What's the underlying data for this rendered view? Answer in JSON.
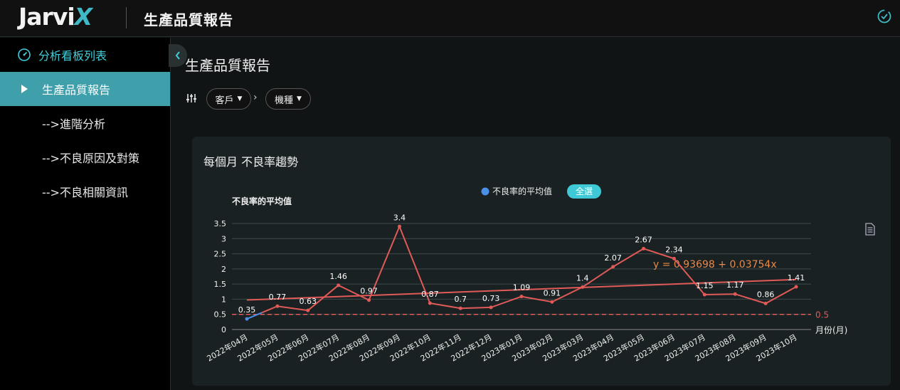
{
  "app": {
    "logo_main": "Jarvi",
    "logo_accent": "X",
    "title": "生產品質報告"
  },
  "sidebar": {
    "header": "分析看板列表",
    "items": [
      {
        "label": "生產品質報告",
        "active": true
      },
      {
        "label": "-->進階分析"
      },
      {
        "label": "-->不良原因及對策"
      },
      {
        "label": "-->不良相關資訊"
      }
    ]
  },
  "main": {
    "title": "生產品質報告",
    "filters": [
      {
        "label": "客戶"
      },
      {
        "label": "機種"
      }
    ]
  },
  "card": {
    "title": "每個月 不良率趨勢",
    "legend": {
      "series_label": "不良率的平均值",
      "select_all": "全選"
    }
  },
  "colors": {
    "accent": "#3fb9c6",
    "line": "#e05a58",
    "active_bg": "#3f9fab",
    "first_segment": "#4a8fe8",
    "trend_label": "#e8894a"
  },
  "chart_data": {
    "type": "line",
    "ylabel": "不良率的平均值",
    "xlabel": "月份(月)",
    "ylim": [
      0,
      3.5
    ],
    "yticks": [
      0,
      0.5,
      1,
      1.5,
      2,
      2.5,
      3,
      3.5
    ],
    "categories": [
      "2022年04月",
      "2022年05月",
      "2022年06月",
      "2022年07月",
      "2022年08月",
      "2022年09月",
      "2022年10月",
      "2022年11月",
      "2022年12月",
      "2023年01月",
      "2023年02月",
      "2023年03月",
      "2023年04月",
      "2023年05月",
      "2023年06月",
      "2023年07月",
      "2023年08月",
      "2023年09月",
      "2023年10月"
    ],
    "series": [
      {
        "name": "不良率的平均值",
        "values": [
          0.35,
          0.77,
          0.63,
          1.46,
          0.97,
          3.4,
          0.87,
          0.7,
          0.73,
          1.09,
          0.91,
          1.4,
          2.07,
          2.67,
          2.34,
          1.15,
          1.17,
          0.86,
          1.41
        ]
      }
    ],
    "trendline": {
      "label": "y = 0.93698 + 0.03754x",
      "intercept": 0.93698,
      "slope": 0.03754
    },
    "reference_line": {
      "value": 0.5,
      "label": "0.5"
    },
    "grid": true,
    "legend": "top"
  }
}
